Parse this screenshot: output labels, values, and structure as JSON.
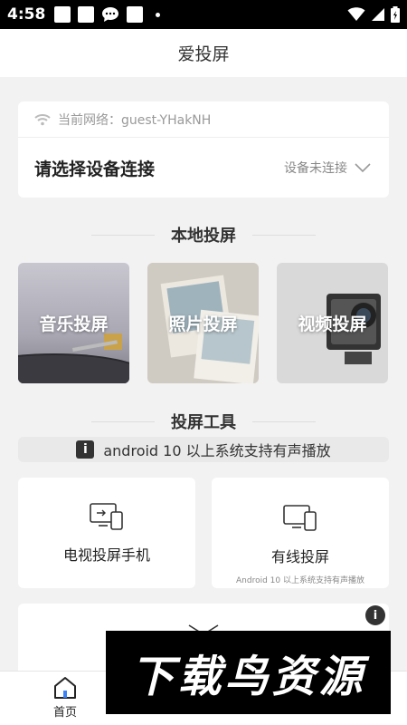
{
  "status_bar": {
    "time": "4:58"
  },
  "header": {
    "title": "爱投屏"
  },
  "network": {
    "label": "当前网络：guest-YHakNH"
  },
  "device": {
    "prompt": "请选择设备连接",
    "status": "设备未连接"
  },
  "local_section": {
    "title": "本地投屏",
    "tiles": [
      {
        "label": "音乐投屏",
        "icon": "music-record-image"
      },
      {
        "label": "照片投屏",
        "icon": "photo-prints-image"
      },
      {
        "label": "视频投屏",
        "icon": "action-camera-image"
      }
    ]
  },
  "tools_section": {
    "title": "投屏工具",
    "notice": "android 10 以上系统支持有声播放",
    "tools": [
      {
        "label": "电视投屏手机",
        "icon": "tv-to-phone-icon",
        "sub": ""
      },
      {
        "label": "有线投屏",
        "icon": "wired-cast-icon",
        "sub": "Android 10 以上系统支持有声播放"
      }
    ]
  },
  "bottom_nav": {
    "items": [
      {
        "label": "首页",
        "icon": "home-icon",
        "active": true
      }
    ]
  },
  "watermark": {
    "text": "下载鸟资源"
  },
  "colors": {
    "accent": "#1a1a1a",
    "background": "#f2f2f2",
    "card": "#ffffff",
    "muted": "#999999"
  }
}
